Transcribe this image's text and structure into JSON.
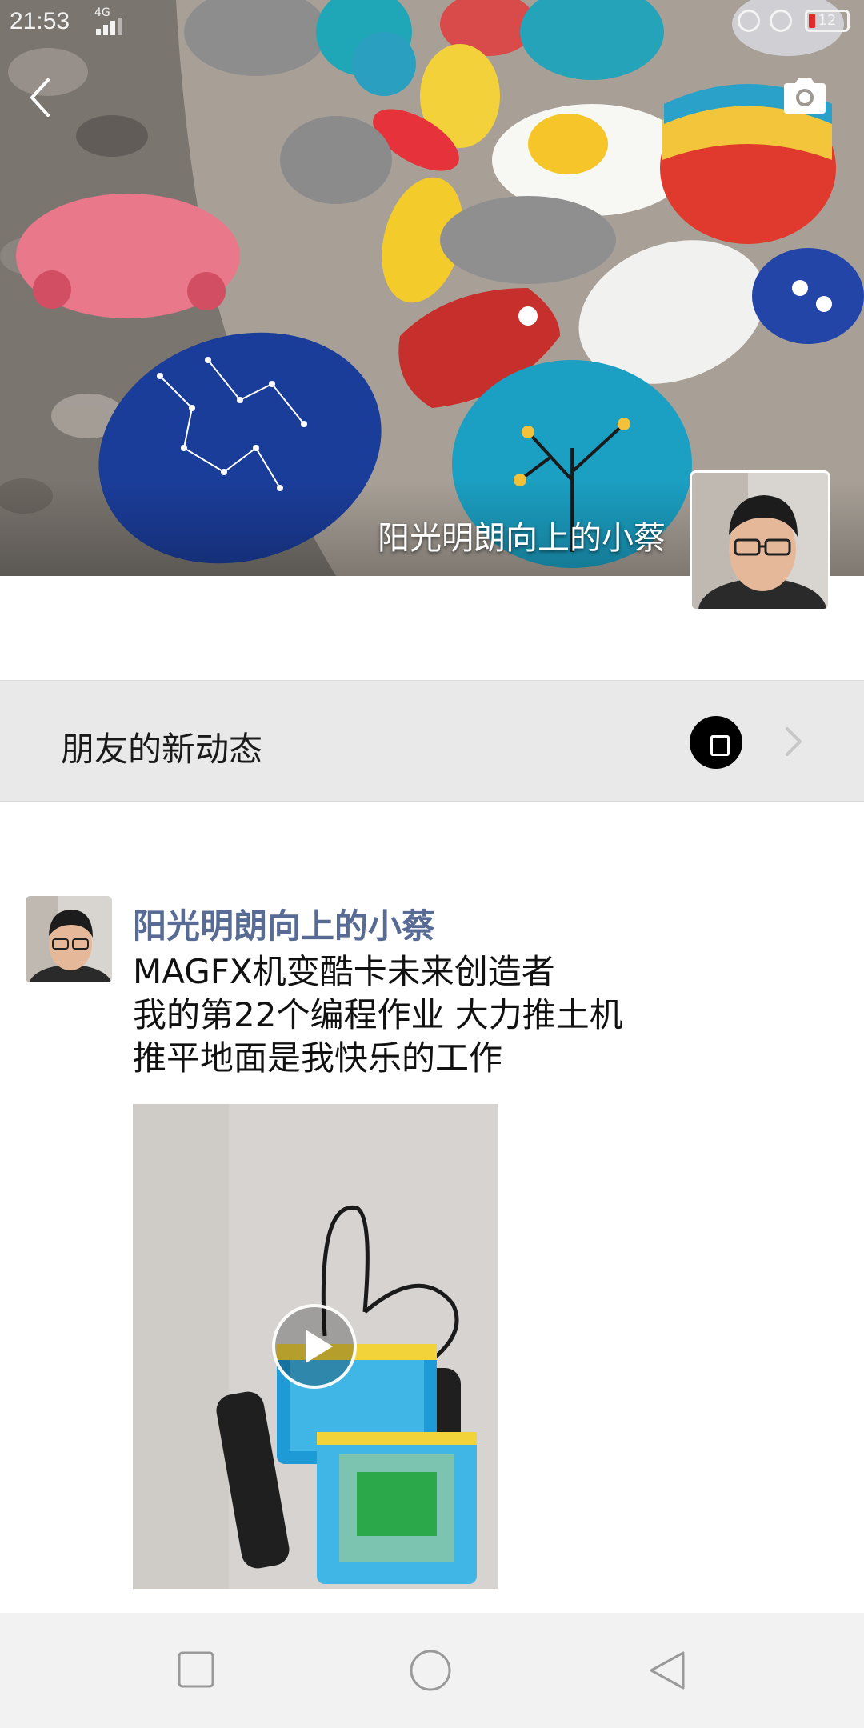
{
  "status_bar": {
    "time": "21:53",
    "network": "4G",
    "battery": "12"
  },
  "header": {
    "username": "阳光明朗向上的小蔡"
  },
  "friends_bar": {
    "label": "朋友的新动态"
  },
  "post": {
    "author": "阳光明朗向上的小蔡",
    "lines": [
      "MAGFX机变酷卡未来创造者",
      "我的第22个编程作业  大力推土机",
      "推平地面是我快乐的工作"
    ]
  },
  "icons": {
    "back": "back-icon",
    "camera": "camera-icon",
    "play": "play-icon",
    "chevron": "chevron-right-icon",
    "nav_recent": "recent-apps-icon",
    "nav_home": "home-icon",
    "nav_back": "nav-back-icon"
  },
  "colors": {
    "link_name": "#576b95",
    "friends_bar_bg": "#e9e9e9",
    "navbar_bg": "#f2f2f2"
  }
}
